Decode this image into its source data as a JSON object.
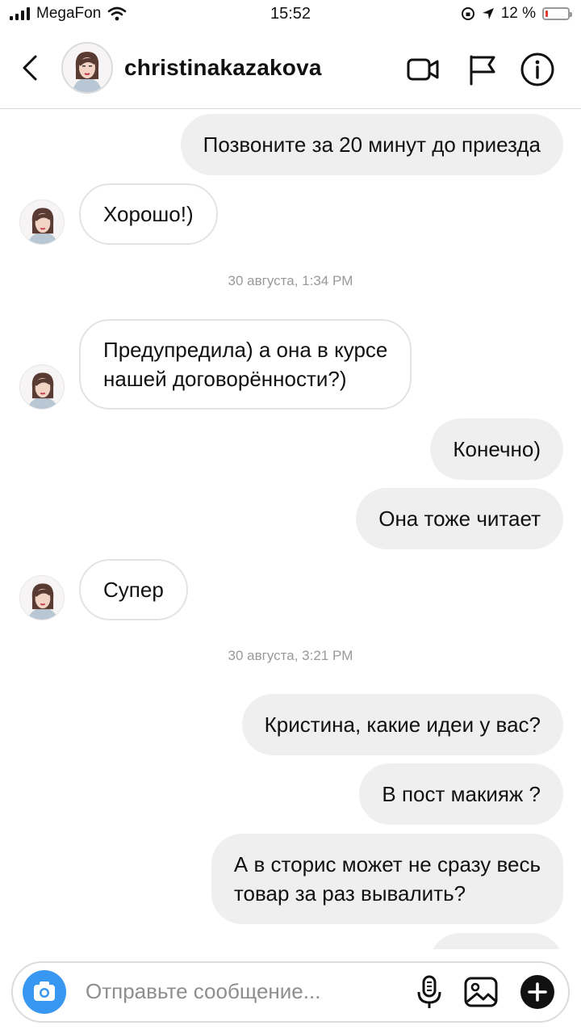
{
  "status": {
    "carrier": "MegaFon",
    "time": "15:52",
    "battery": "12 %",
    "battery_level": 0.12
  },
  "header": {
    "username": "christinakazakova"
  },
  "messages": [
    {
      "text": "Позвоните за 20 минут до приезда",
      "side": "out"
    },
    {
      "text": "Хорошо!)",
      "side": "in"
    },
    {
      "timestamp": "30 августа, 1:34 PM"
    },
    {
      "line1": "Предупредила) а она в курсе",
      "line2": "нашей договорённости?)",
      "side": "in"
    },
    {
      "text": "Конечно)",
      "side": "out"
    },
    {
      "text": "Она тоже читает",
      "side": "out"
    },
    {
      "text": "Супер",
      "side": "in"
    },
    {
      "timestamp": "30 августа, 3:21 PM"
    },
    {
      "text": "Кристина, какие идеи у вас?",
      "side": "out"
    },
    {
      "text": "В пост макияж ?",
      "side": "out"
    },
    {
      "line1": "А в сторис может не сразу весь",
      "line2": "товар за раз вывалить?",
      "side": "out"
    }
  ],
  "composer": {
    "placeholder": "Отправьте сообщение..."
  },
  "icons": {
    "back": "chevron-left-icon",
    "video": "video-call-icon",
    "flag": "flag-icon",
    "info": "info-icon",
    "camera": "camera-icon",
    "mic": "microphone-icon",
    "gallery": "gallery-icon",
    "add": "plus-icon"
  },
  "colors": {
    "accent": "#3897f0",
    "outgoing_bubble": "#efefef",
    "battery_low": "#e53935"
  }
}
